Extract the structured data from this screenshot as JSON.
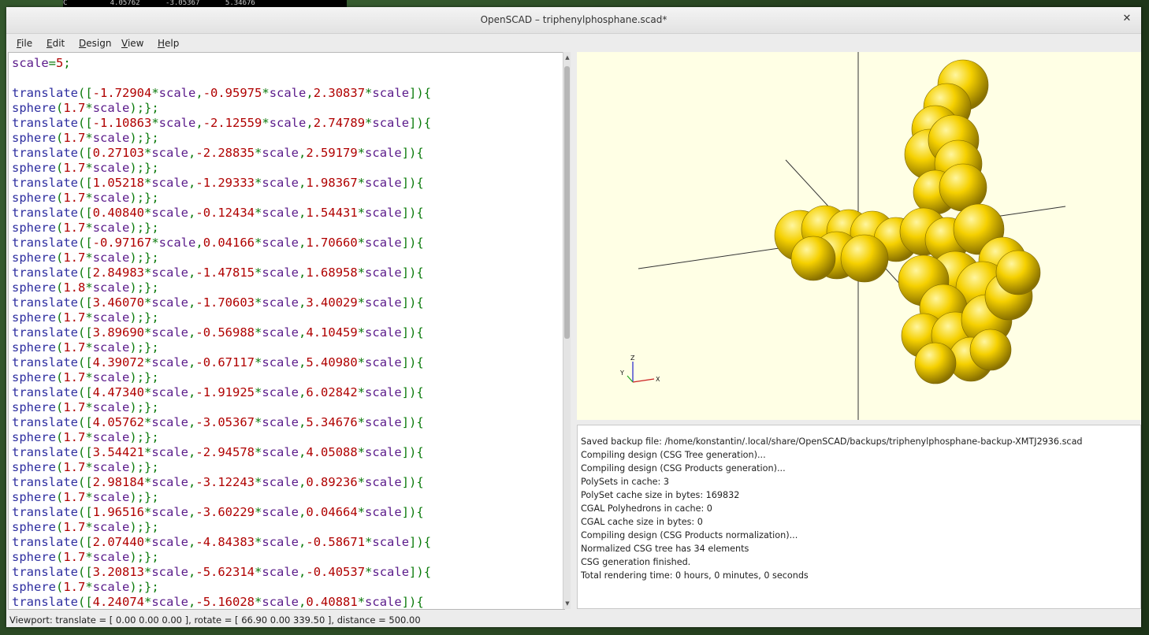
{
  "background": {
    "terminal_text": "C          4.05762      -3.05367      5.34676"
  },
  "window": {
    "title": "OpenSCAD – triphenylphosphane.scad*",
    "close_icon": "close-x"
  },
  "menu": {
    "items": [
      {
        "first": "F",
        "rest": "ile"
      },
      {
        "first": "E",
        "rest": "dit"
      },
      {
        "first": "D",
        "rest": "esign"
      },
      {
        "first": "V",
        "rest": "iew"
      },
      {
        "first": "H",
        "rest": "elp"
      }
    ]
  },
  "editor": {
    "scale_line": {
      "var": "scale",
      "value": "5"
    },
    "atoms": [
      {
        "x": "-1.72904",
        "y": "-0.95975",
        "z": "2.30837",
        "r": "1.7"
      },
      {
        "x": "-1.10863",
        "y": "-2.12559",
        "z": "2.74789",
        "r": "1.7"
      },
      {
        "x": "0.27103",
        "y": "-2.28835",
        "z": "2.59179",
        "r": "1.7"
      },
      {
        "x": "1.05218",
        "y": "-1.29333",
        "z": "1.98367",
        "r": "1.7"
      },
      {
        "x": "0.40840",
        "y": "-0.12434",
        "z": "1.54431",
        "r": "1.7"
      },
      {
        "x": "-0.97167",
        "y": "0.04166",
        "z": "1.70660",
        "r": "1.7"
      },
      {
        "x": "2.84983",
        "y": "-1.47815",
        "z": "1.68958",
        "r": "1.8"
      },
      {
        "x": "3.46070",
        "y": "-1.70603",
        "z": "3.40029",
        "r": "1.7"
      },
      {
        "x": "3.89690",
        "y": "-0.56988",
        "z": "4.10459",
        "r": "1.7"
      },
      {
        "x": "4.39072",
        "y": "-0.67117",
        "z": "5.40980",
        "r": "1.7"
      },
      {
        "x": "4.47340",
        "y": "-1.91925",
        "z": "6.02842",
        "r": "1.7"
      },
      {
        "x": "4.05762",
        "y": "-3.05367",
        "z": "5.34676",
        "r": "1.7"
      },
      {
        "x": "3.54421",
        "y": "-2.94578",
        "z": "4.05088",
        "r": "1.7"
      },
      {
        "x": "2.98184",
        "y": "-3.12243",
        "z": "0.89236",
        "r": "1.7"
      },
      {
        "x": "1.96516",
        "y": "-3.60229",
        "z": "0.04664",
        "r": "1.7"
      },
      {
        "x": "2.07440",
        "y": "-4.84383",
        "z": "-0.58671",
        "r": "1.7"
      },
      {
        "x": "3.20813",
        "y": "-5.62314",
        "z": "-0.40537",
        "r": "1.7"
      },
      {
        "x": "4.24074",
        "y": "-5.16028",
        "z": "0.40881",
        "r": null
      }
    ]
  },
  "viewport": {
    "background_color": "#ffffe5",
    "sphere_color": "#f5d000",
    "axis_labels": {
      "x": "X",
      "y": "Y",
      "z": "Z"
    }
  },
  "console": {
    "lines": [
      "Saved backup file: /home/konstantin/.local/share/OpenSCAD/backups/triphenylphosphane-backup-XMTJ2936.scad",
      "Compiling design (CSG Tree generation)...",
      "Compiling design (CSG Products generation)...",
      "PolySets in cache: 3",
      "PolySet cache size in bytes: 169832",
      "CGAL Polyhedrons in cache: 0",
      "CGAL cache size in bytes: 0",
      "Compiling design (CSG Products normalization)...",
      "Normalized CSG tree has 34 elements",
      "CSG generation finished.",
      "Total rendering time: 0 hours, 0 minutes, 0 seconds"
    ]
  },
  "status": {
    "text": "Viewport: translate = [ 0.00 0.00 0.00 ], rotate = [ 66.90 0.00 339.50 ], distance = 500.00"
  }
}
